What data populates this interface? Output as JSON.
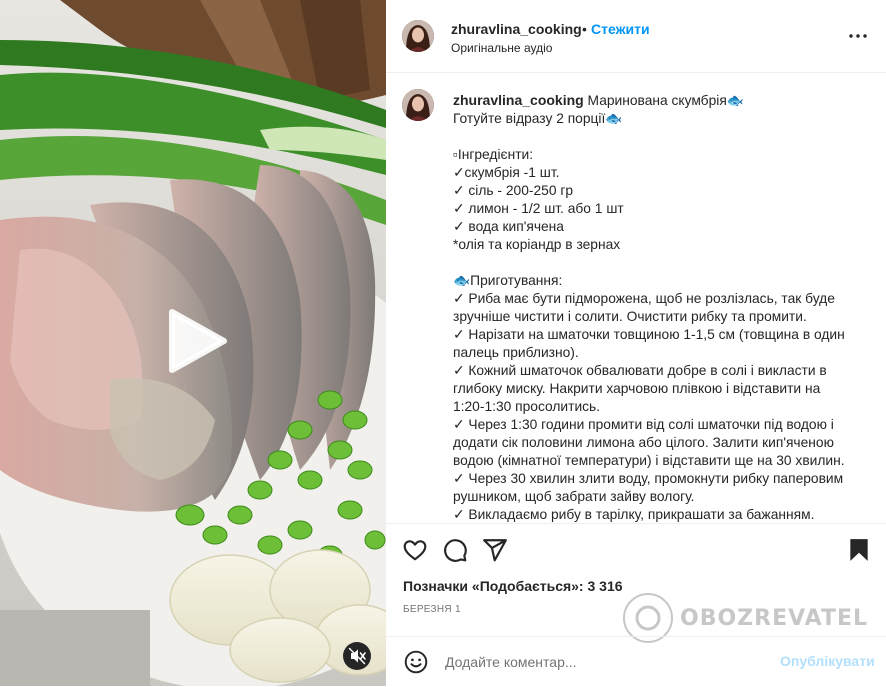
{
  "post": {
    "username": "zhuravlina_cooking",
    "follow_label": "Стежити",
    "audio_label": "Оригінальне аудіо",
    "caption_title": "Маринована скумбрія🐟",
    "caption_lines": [
      "Готуйте відразу 2 порції🐟",
      "",
      "▫Інгредієнти:",
      "✓скумбрія -1 шт.",
      "✓ сіль - 200-250 гр",
      "✓ лимон - 1/2 шт. або 1 шт",
      "✓ вода кип'ячена",
      "*олія та коріандр в зернах",
      "",
      "🐟Приготування:",
      "✓ Риба має бути підморожена, щоб не розлізлась, так буде",
      "зручніше чистити і солити. Очистити рибку та промити.",
      "✓ Нарізати на шматочки товщиною 1-1,5 см (товщина в один",
      "палець приблизно).",
      "✓ Кожний шматочок обвалювати добре в солі і викласти в",
      "глибоку миску. Накрити харчовою плівкою і відставити на",
      "1:20-1:30 просолитись.",
      "✓ Через 1:30 години промити від солі шматочки під водою і",
      "додати сік половини лимона або цілого. Залити кип'яченою",
      "водою (кімнатної температури) і відставити ще на 30 хвилин.",
      "✓ Через 30 хвилин злити воду, промокнути рибку паперовим",
      "рушником, щоб забрати зайву вологу.",
      "✓ Викладаємо рибу в тарілку, прикрашати за бажанням."
    ],
    "likes_text": "Позначки «Подобається»: 3 316",
    "date_text": "БЕРЕЗНЯ 1",
    "comment_placeholder": "Додайте коментар...",
    "publish_label": "Опублікувати"
  },
  "watermark": {
    "text": "OBOZREVATEL"
  },
  "icons": {
    "more": "more-options-icon",
    "like": "heart-icon",
    "comment": "comment-icon",
    "share": "share-icon",
    "save": "bookmark-icon",
    "emoji": "emoji-icon",
    "play": "play-icon",
    "mute": "mute-icon"
  },
  "colors": {
    "accent": "#0095f6",
    "publish_disabled": "#b2dffc",
    "text": "#262626",
    "muted": "#737373"
  }
}
